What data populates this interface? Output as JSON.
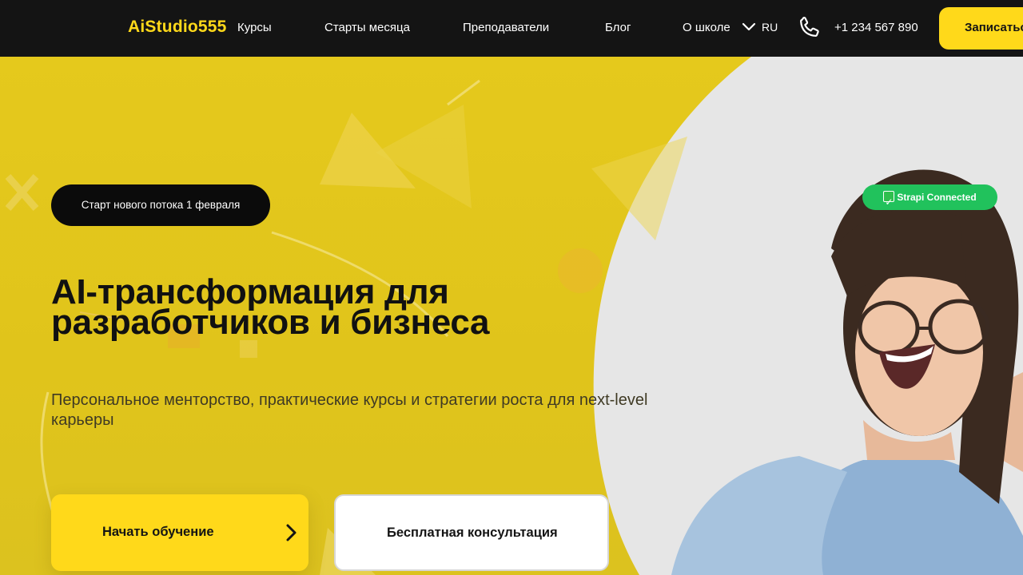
{
  "nav": {
    "logo": "AiStudio555",
    "links": [
      "Курсы",
      "Старты месяца",
      "Преподаватели",
      "Блог",
      "О школе"
    ],
    "language": "RU",
    "phone": "+1 234 567 890",
    "cta_label": "Записаться"
  },
  "hero": {
    "badge": "Старт нового потока 1 февраля",
    "status_badge": "Strapi Connected",
    "title_line1": "AI-трансформация для",
    "title_line2": "разработчиков и бизнеса",
    "subtitle": "Персональное менторство, практические курсы и стратегии роста для next-level карьеры",
    "primary_button": "Начать обучение",
    "secondary_button": "Бесплатная консультация"
  },
  "colors": {
    "accent": "#ffd91a",
    "nav_bg": "#141414",
    "hero_bg": "#e2c51a",
    "status_green": "#21c25c"
  },
  "icons": [
    "chevron-down-icon",
    "phone-icon",
    "checkmark-icon",
    "chevron-right-icon"
  ]
}
